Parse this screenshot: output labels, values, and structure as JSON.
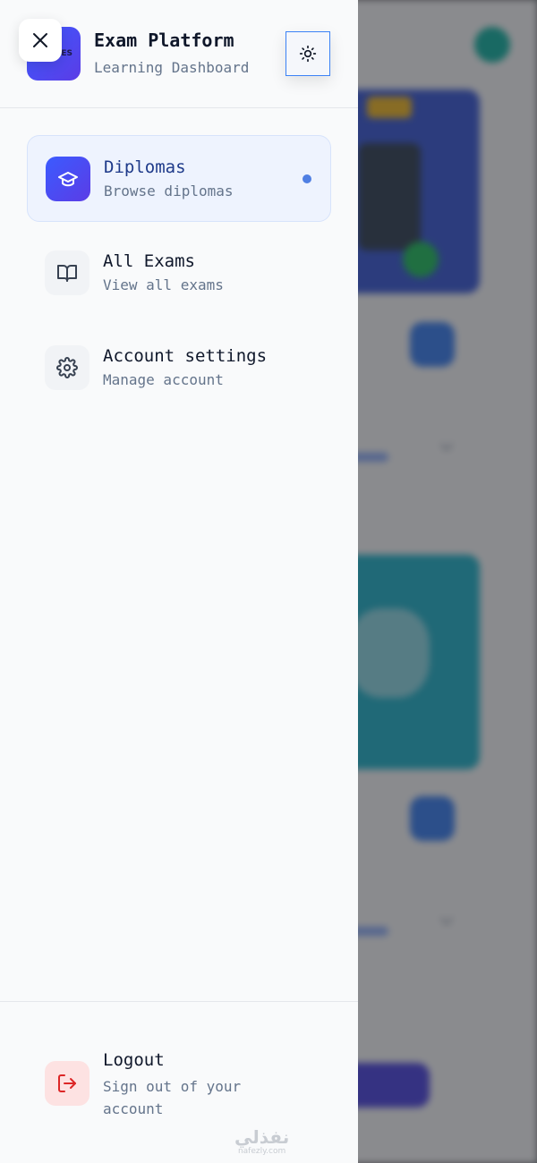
{
  "brand": {
    "title": "Exam Platform",
    "subtitle": "Learning Dashboard"
  },
  "header": {
    "close_icon": "close-icon",
    "theme_icon": "sun-icon"
  },
  "nav": {
    "items": [
      {
        "label": "Diplomas",
        "description": "Browse diplomas",
        "icon": "graduation-cap-icon",
        "active": true
      },
      {
        "label": "All Exams",
        "description": "View all exams",
        "icon": "book-open-icon",
        "active": false
      },
      {
        "label": "Account settings",
        "description": "Manage account",
        "icon": "gear-icon",
        "active": false
      }
    ]
  },
  "footer": {
    "logout_label": "Logout",
    "logout_description": "Sign out of your account",
    "logout_icon": "logout-icon"
  },
  "watermark": {
    "logo_text": "نفذلي",
    "logo_domain": "nafezly.com"
  },
  "colors": {
    "accent": "#4f46e5",
    "active_bg": "#eef3fe",
    "logout_bg": "#fde2e2",
    "logout_icon": "#dc2626"
  }
}
